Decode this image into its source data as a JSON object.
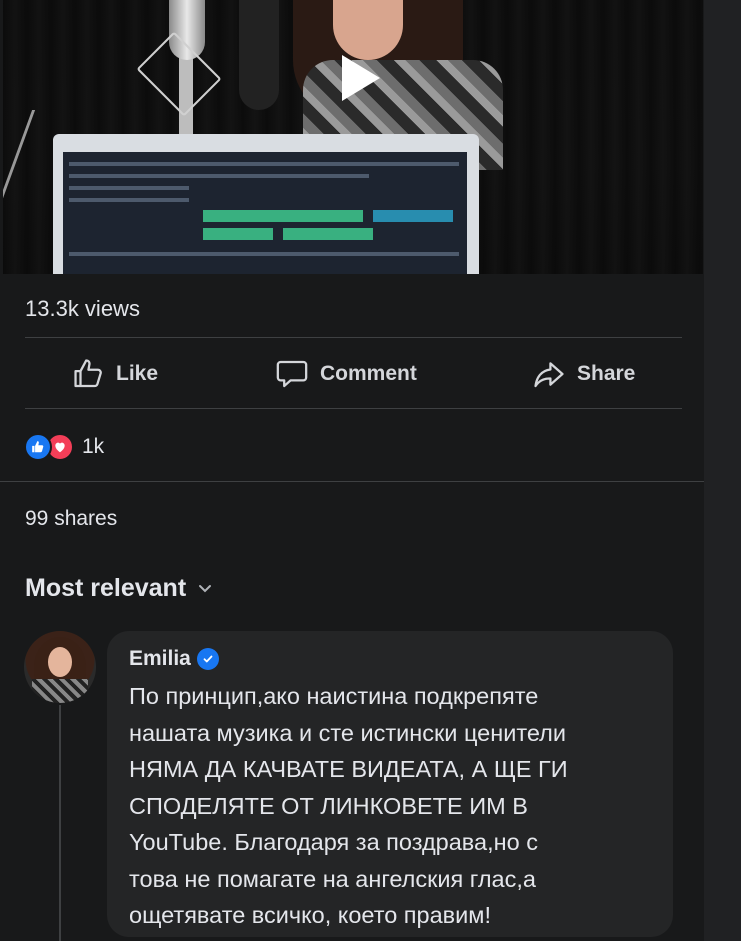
{
  "video": {
    "play_icon": "play-icon",
    "views": "13.3k views"
  },
  "actions": {
    "like": "Like",
    "comment": "Comment",
    "share": "Share"
  },
  "reactions": {
    "icons": [
      "like-reaction-icon",
      "love-reaction-icon"
    ],
    "count": "1k"
  },
  "shares": "99 shares",
  "sort": {
    "label": "Most relevant",
    "icon": "chevron-down-icon"
  },
  "comment": {
    "author": "Emilia",
    "verified_icon": "verified-badge-icon",
    "lines": [
      "По принцип,ако наистина подкрепяте",
      "нашата музика и сте истински ценители",
      "НЯМА ДА КАЧВАТЕ ВИДЕАТА, А ЩЕ ГИ",
      "СПОДЕЛЯТЕ ОТ ЛИНКОВЕТЕ ИМ В",
      "YouTube. Благодаря за поздрава,но с",
      "това не помагате на ангелския глас,а",
      "ощетявате всичко, което правим!"
    ]
  },
  "colors": {
    "background": "#18191a",
    "bubble": "#242526",
    "text": "#e4e6eb",
    "like_blue": "#1877f2",
    "love_red": "#f33e58"
  }
}
